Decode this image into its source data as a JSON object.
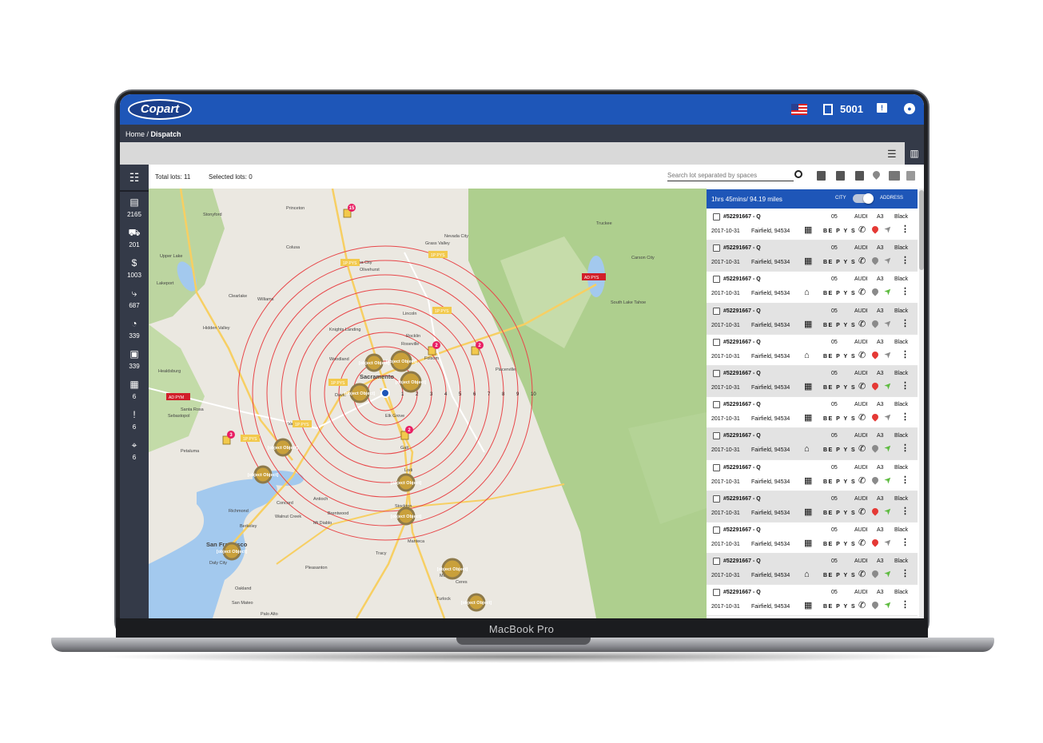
{
  "device": {
    "label": "MacBook Pro"
  },
  "header": {
    "logo": "Copart",
    "yard_number": "5001",
    "country_flag": "us-flag-icon"
  },
  "breadcrumb": {
    "home": "Home",
    "separator": " / ",
    "current": "Dispatch"
  },
  "sidebar": {
    "items": [
      {
        "icon": "lots-icon",
        "count": "2165"
      },
      {
        "icon": "tow-icon",
        "count": "201"
      },
      {
        "icon": "payment-icon",
        "count": "1003"
      },
      {
        "icon": "route-icon",
        "count": "687"
      },
      {
        "icon": "gauge-icon",
        "count": "339"
      },
      {
        "icon": "bus-icon",
        "count": "339"
      },
      {
        "icon": "calendar-icon",
        "count": "6"
      },
      {
        "icon": "alert-icon",
        "count": "6"
      },
      {
        "icon": "no-location-icon",
        "count": "6"
      }
    ]
  },
  "filters": {
    "total_lots": "Total lots: 11",
    "selected_lots": "Selected lots: 0",
    "search_placeholder": "Search lot separated by spaces"
  },
  "map": {
    "towns": [
      "Stonyford",
      "Princeton",
      "Grass Valley",
      "Truckee",
      "Upper Lake",
      "Colusa",
      "Nevada City",
      "Yuba City",
      "Carson City",
      "Olivehurst",
      "Williams",
      "Auburn",
      "Lincoln",
      "Rocklin",
      "Roseville",
      "Folsom",
      "Knights Landing",
      "Woodland",
      "Davis",
      "Sacramento",
      "Elk Grove",
      "Galt",
      "Lodi",
      "Stockton",
      "Manteca",
      "Santa Rosa",
      "Sebastopol",
      "Petaluma",
      "Vacaville",
      "Concord",
      "Antioch",
      "Brentwood",
      "Walnut Creek",
      "Richmond",
      "Berkeley",
      "San Francisco",
      "Daly City",
      "Oakland",
      "San Mateo",
      "Pleasanton",
      "Tracy",
      "Modesto",
      "Turlock",
      "Placerville",
      "South Lake Tahoe",
      "Healdsburg",
      "Hidden Valley",
      "Clearlake",
      "Lakeport",
      "Mt Diablo",
      "Palo Alto",
      "Ceres"
    ],
    "radius_labels": [
      "1",
      "2",
      "3",
      "4",
      "5",
      "6",
      "7",
      "8",
      "9",
      "10"
    ],
    "markers": [
      {
        "label": "30PYS",
        "tone": "gold"
      },
      {
        "label": "35PYS",
        "tone": "gold"
      },
      {
        "label": "6P",
        "tone": "gold"
      },
      {
        "label": "2SPYS",
        "tone": "gold"
      },
      {
        "label": "12P",
        "tone": "gold"
      },
      {
        "label": "9PYS",
        "tone": "gold"
      },
      {
        "label": "11P",
        "tone": "gold"
      },
      {
        "label": "4P",
        "tone": "gold"
      },
      {
        "label": "5PYS",
        "tone": "gold"
      },
      {
        "label": "9P",
        "tone": "gold"
      },
      {
        "label": "3P",
        "tone": "gold"
      }
    ],
    "badges": [
      "15",
      "2",
      "2",
      "3",
      "2"
    ],
    "tags": [
      "1P PYS",
      "1P PYS",
      "1P PYS",
      "1P PYS",
      "1P PYS",
      "1P PYS",
      "AD PYM",
      "AD PYS"
    ]
  },
  "panel": {
    "summary": "1hrs 45mins/ 94.19 miles",
    "toggle_left": "CITY",
    "toggle_right": "ADDRESS",
    "rows": [
      {
        "lot": "#52291667 - Q",
        "num": "05",
        "make": "AUDI",
        "model": "A3",
        "color": "Black",
        "date": "2017-10-31",
        "location": "Fairfield, 94534",
        "building": "business",
        "codes": "BE P Y S",
        "pin": "#e53935",
        "arrow": "#8a8a8a"
      },
      {
        "lot": "#52291667 - Q",
        "num": "05",
        "make": "AUDI",
        "model": "A3",
        "color": "Black",
        "date": "2017-10-31",
        "location": "Fairfield, 94534",
        "building": "business",
        "codes": "BE P Y S",
        "pin": "#8a8a8a",
        "arrow": "#8a8a8a"
      },
      {
        "lot": "#52291667 - Q",
        "num": "05",
        "make": "AUDI",
        "model": "A3",
        "color": "Black",
        "date": "2017-10-31",
        "location": "Fairfield, 94534",
        "building": "home",
        "codes": "BE P Y S",
        "pin": "#8a8a8a",
        "arrow": "#5dbb3f"
      },
      {
        "lot": "#52291667 - Q",
        "num": "05",
        "make": "AUDI",
        "model": "A3",
        "color": "Black",
        "date": "2017-10-31",
        "location": "Fairfield, 94534",
        "building": "business",
        "codes": "BE P Y S",
        "pin": "#8a8a8a",
        "arrow": "#8a8a8a"
      },
      {
        "lot": "#52291667 - Q",
        "num": "05",
        "make": "AUDI",
        "model": "A3",
        "color": "Black",
        "date": "2017-10-31",
        "location": "Fairfield, 94534",
        "building": "home",
        "codes": "BE P Y S",
        "pin": "#e53935",
        "arrow": "#8a8a8a"
      },
      {
        "lot": "#52291667 - Q",
        "num": "05",
        "make": "AUDI",
        "model": "A3",
        "color": "Black",
        "date": "2017-10-31",
        "location": "Fairfield, 94534",
        "building": "business",
        "codes": "BE P Y S",
        "pin": "#e53935",
        "arrow": "#5dbb3f"
      },
      {
        "lot": "#52291667 - Q",
        "num": "05",
        "make": "AUDI",
        "model": "A3",
        "color": "Black",
        "date": "2017-10-31",
        "location": "Fairfield, 94534",
        "building": "business",
        "codes": "BE P Y S",
        "pin": "#e53935",
        "arrow": "#8a8a8a"
      },
      {
        "lot": "#52291667 - Q",
        "num": "05",
        "make": "AUDI",
        "model": "A3",
        "color": "Black",
        "date": "2017-10-31",
        "location": "Fairfield, 94534",
        "building": "home",
        "codes": "BE P Y S",
        "pin": "#8a8a8a",
        "arrow": "#5dbb3f"
      },
      {
        "lot": "#52291667 - Q",
        "num": "05",
        "make": "AUDI",
        "model": "A3",
        "color": "Black",
        "date": "2017-10-31",
        "location": "Fairfield, 94534",
        "building": "business",
        "codes": "BE P Y S",
        "pin": "#8a8a8a",
        "arrow": "#5dbb3f"
      },
      {
        "lot": "#52291667 - Q",
        "num": "05",
        "make": "AUDI",
        "model": "A3",
        "color": "Black",
        "date": "2017-10-31",
        "location": "Fairfield, 94534",
        "building": "business",
        "codes": "BE P Y S",
        "pin": "#e53935",
        "arrow": "#5dbb3f"
      },
      {
        "lot": "#52291667 - Q",
        "num": "05",
        "make": "AUDI",
        "model": "A3",
        "color": "Black",
        "date": "2017-10-31",
        "location": "Fairfield, 94534",
        "building": "business",
        "codes": "BE P Y S",
        "pin": "#e53935",
        "arrow": "#8a8a8a"
      },
      {
        "lot": "#52291667 - Q",
        "num": "05",
        "make": "AUDI",
        "model": "A3",
        "color": "Black",
        "date": "2017-10-31",
        "location": "Fairfield, 94534",
        "building": "home",
        "codes": "BE P Y S",
        "pin": "#8a8a8a",
        "arrow": "#5dbb3f"
      },
      {
        "lot": "#52291667 - Q",
        "num": "05",
        "make": "AUDI",
        "model": "A3",
        "color": "Black",
        "date": "2017-10-31",
        "location": "Fairfield, 94534",
        "building": "business",
        "codes": "BE P Y S",
        "pin": "#8a8a8a",
        "arrow": "#5dbb3f"
      }
    ]
  },
  "colors": {
    "brand_blue": "#1e56b8",
    "sidebar": "#343a48",
    "radius_ring": "#e8474a",
    "marker_gold": "#c9a03b",
    "badge_pink": "#e91e63"
  }
}
